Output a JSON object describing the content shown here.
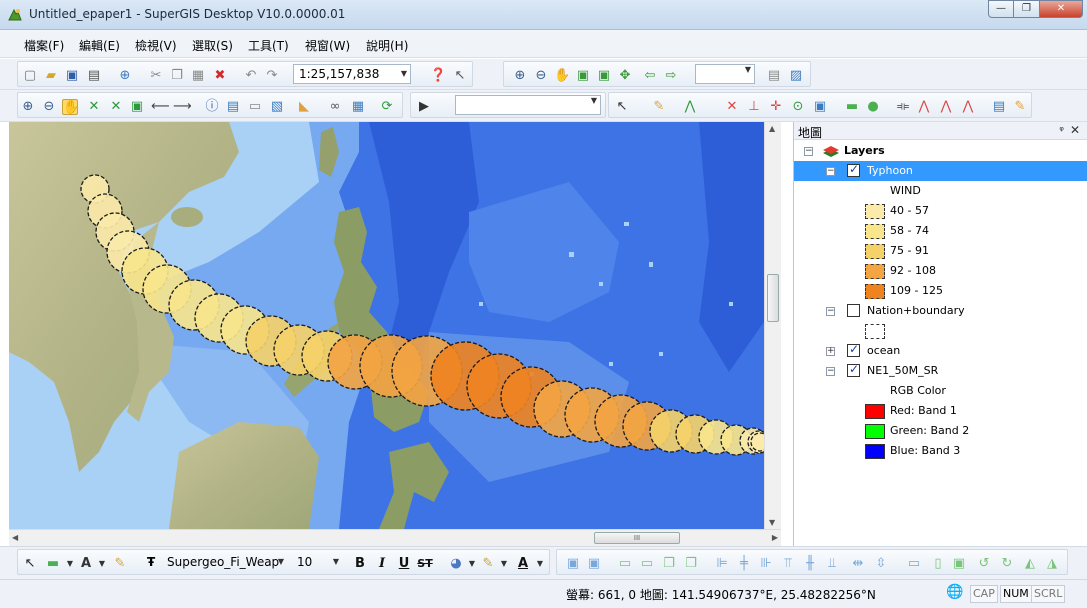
{
  "window": {
    "title": "Untitled_epaper1 - SuperGIS Desktop V10.0.0000.01",
    "min_glyph": "—",
    "max_glyph": "❐",
    "close_glyph": "✕"
  },
  "menu": [
    "檔案(F)",
    "編輯(E)",
    "檢視(V)",
    "選取(S)",
    "工具(T)",
    "視窗(W)",
    "說明(H)"
  ],
  "toolbar": {
    "scale": "1:25,157,838"
  },
  "panel": {
    "title": "地圖",
    "pin_glyph": "ᵠ",
    "close_glyph": "✕",
    "root_label": "Layers",
    "layers": [
      {
        "name": "Typhoon",
        "checked": true,
        "legend_field": "WIND",
        "classes": [
          {
            "label": "40 - 57",
            "color": "#fbeaaa"
          },
          {
            "label": "58 - 74",
            "color": "#f8e58c"
          },
          {
            "label": "75 - 91",
            "color": "#f5d169"
          },
          {
            "label": "92 - 108",
            "color": "#f3a443"
          },
          {
            "label": "109 - 125",
            "color": "#ee8320"
          }
        ]
      },
      {
        "name": "Nation+boundary",
        "checked": false
      },
      {
        "name": "ocean",
        "checked": true
      },
      {
        "name": "NE1_50M_SR",
        "checked": true,
        "legend_field": "RGB Color",
        "bands": [
          {
            "label": "Red: Band 1",
            "color": "#ff0000"
          },
          {
            "label": "Green: Band 2",
            "color": "#00ff00"
          },
          {
            "label": "Blue: Band 3",
            "color": "#0000ff"
          }
        ]
      }
    ]
  },
  "format_bar": {
    "font_name": "Supergeo_Fi_Weap",
    "font_size": "10",
    "bold": "B",
    "italic": "I",
    "underline": "U",
    "strike": "ST"
  },
  "status": {
    "coords": "螢幕: 661, 0  地圖: 141.54906737°E, 25.48282256°N",
    "keys": [
      "CAP",
      "NUM",
      "SCRL"
    ]
  },
  "typhoon_track": {
    "wind_classes": [
      1,
      1,
      1,
      1,
      2,
      2,
      2,
      2,
      2,
      3,
      3,
      3,
      4,
      4,
      4,
      5,
      5,
      5,
      4,
      4,
      4,
      4,
      3,
      3,
      2,
      2,
      1,
      1,
      1
    ]
  },
  "scrollbar_thumb_grip": "III"
}
